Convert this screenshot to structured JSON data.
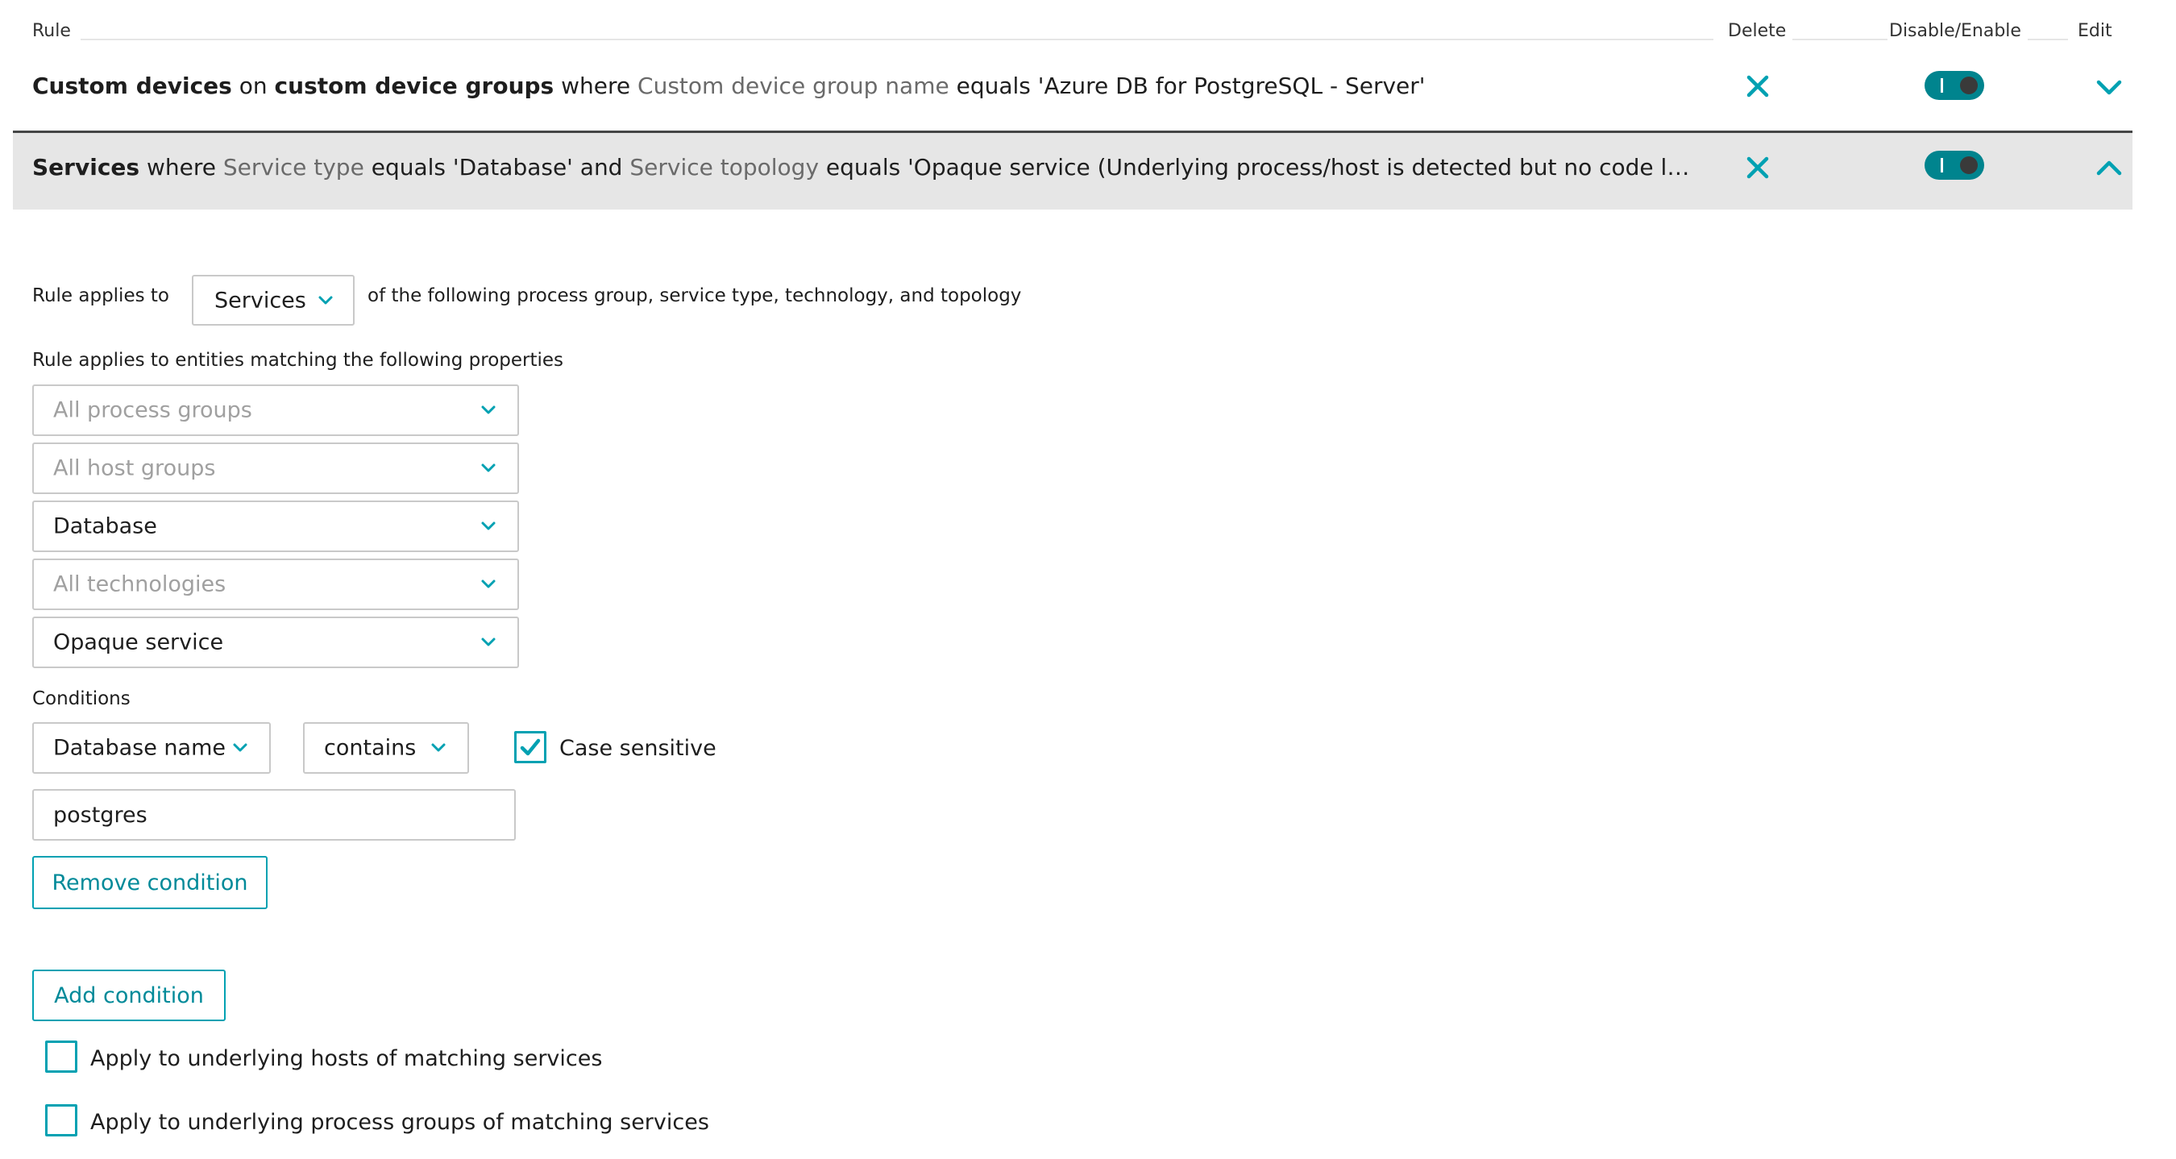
{
  "table_header": {
    "rule": "Rule",
    "delete": "Delete",
    "toggle": "Disable/Enable",
    "edit": "Edit"
  },
  "rules": [
    {
      "parts": [
        {
          "text": "Custom devices",
          "style": "bold"
        },
        {
          "text": " on ",
          "style": "normal"
        },
        {
          "text": "custom device groups",
          "style": "bold"
        },
        {
          "text": " where ",
          "style": "normal"
        },
        {
          "text": "Custom device group name",
          "style": "gray"
        },
        {
          "text": " equals 'Azure DB for PostgreSQL - Server'",
          "style": "normal"
        }
      ],
      "enabled": true,
      "expanded": false
    },
    {
      "parts": [
        {
          "text": "Services",
          "style": "bold"
        },
        {
          "text": " where ",
          "style": "normal"
        },
        {
          "text": "Service type",
          "style": "gray"
        },
        {
          "text": " equals 'Database' and ",
          "style": "normal"
        },
        {
          "text": "Service topology",
          "style": "gray"
        },
        {
          "text": " equals 'Opaque service (Underlying process/host is detected but no code level insight availabl…",
          "style": "normal"
        }
      ],
      "enabled": true,
      "expanded": true
    }
  ],
  "editor": {
    "applies_to_label": "Rule applies to",
    "applies_to_value": "Services",
    "applies_to_suffix": "of the following process group, service type, technology, and topology",
    "properties_label": "Rule applies to entities matching the following properties",
    "process_groups": "All process groups",
    "host_groups": "All host groups",
    "service_type": "Database",
    "technologies": "All technologies",
    "topology": "Opaque service",
    "conditions_label": "Conditions",
    "condition_key": "Database name",
    "condition_operator": "contains",
    "case_sensitive_label": "Case sensitive",
    "case_sensitive_checked": true,
    "condition_value": "postgres",
    "remove_condition": "Remove condition",
    "add_condition": "Add condition",
    "apply_hosts_label": "Apply to underlying hosts of matching services",
    "apply_process_groups_label": "Apply to underlying process groups of matching services",
    "apply_hosts_checked": false,
    "apply_process_groups_checked": false
  },
  "colors": {
    "accent": "#00a1b2",
    "toggle_on": "#00848e",
    "expanded_row_bg": "#e6e6e6"
  }
}
